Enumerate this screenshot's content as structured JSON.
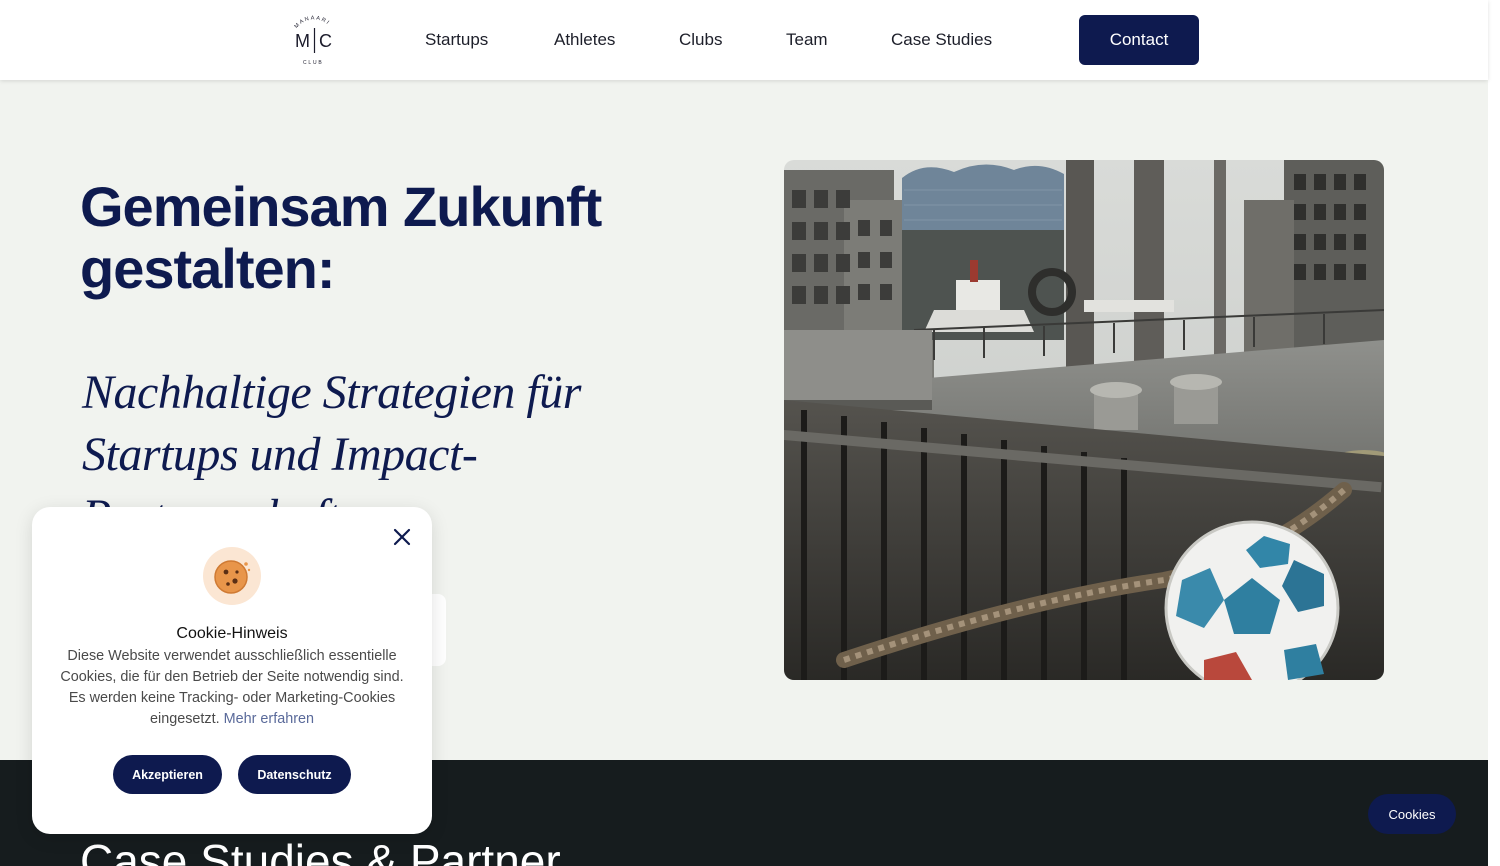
{
  "header": {
    "logo": {
      "initials_left": "M",
      "initials_right": "C",
      "arc_top": "MANAARI",
      "arc_bottom": "CLUB"
    },
    "nav": [
      {
        "label": "Startups"
      },
      {
        "label": "Athletes"
      },
      {
        "label": "Clubs"
      },
      {
        "label": "Team"
      },
      {
        "label": "Case Studies"
      }
    ],
    "contact_label": "Contact"
  },
  "hero": {
    "title": "Gemeinsam Zukunft gestalten:",
    "subtitle": "Nachhaltige Strategien für Startups und Impact-Partnerschaften"
  },
  "section": {
    "heading": "Case Studies & Partner"
  },
  "cookie_banner": {
    "title": "Cookie-Hinweis",
    "text": "Diese Website verwendet ausschließlich essentielle Cookies, die für den Betrieb der Seite notwendig sind. Es werden keine Tracking- oder Marketing-Cookies eingesetzt.",
    "more_link": "Mehr erfahren",
    "accept_label": "Akzeptieren",
    "privacy_label": "Datenschutz"
  },
  "cookies_pill_label": "Cookies",
  "colors": {
    "primary_navy": "#0e1a4f",
    "background": "#f1f3ef",
    "dark_section": "#161c1e"
  },
  "icons": {
    "close": "close-icon",
    "cookie": "cookie-icon"
  }
}
